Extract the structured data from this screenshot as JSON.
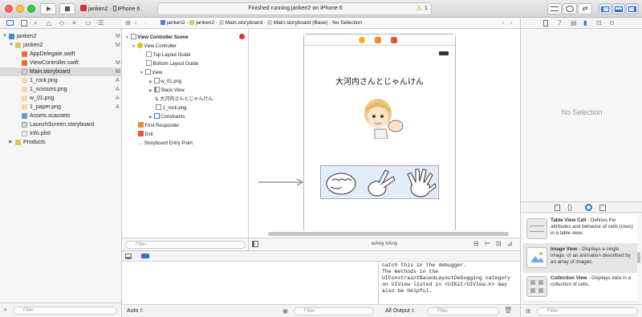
{
  "toolbar": {
    "scheme": "janken2",
    "device": "iPhone 6",
    "status": "Finished running janken2 on iPhone 6",
    "warning_count": "1"
  },
  "navigator": {
    "items": [
      {
        "label": "janken2",
        "badge": "M"
      },
      {
        "label": "janken2",
        "badge": "M"
      },
      {
        "label": "AppDelegate.swift",
        "badge": ""
      },
      {
        "label": "ViewController.swift",
        "badge": "M"
      },
      {
        "label": "Main.storyboard",
        "badge": "M"
      },
      {
        "label": "1_rock.png",
        "badge": "A"
      },
      {
        "label": "1_scissors.png",
        "badge": "A"
      },
      {
        "label": "w_01.png",
        "badge": "A"
      },
      {
        "label": "1_paper.png",
        "badge": "A"
      },
      {
        "label": "Assets.xcassets",
        "badge": ""
      },
      {
        "label": "LaunchScreen.storyboard",
        "badge": ""
      },
      {
        "label": "Info.plist",
        "badge": ""
      },
      {
        "label": "Products",
        "badge": ""
      }
    ],
    "filter_placeholder": "Filter"
  },
  "jumpbar": [
    "janken2",
    "janken2",
    "Main.storyboard",
    "Main.storyboard (Base)",
    "No Selection"
  ],
  "outline": {
    "items": [
      "View Controller Scene",
      "View Controller",
      "Top Layout Guide",
      "Bottom Layout Guide",
      "View",
      "w_01.png",
      "Stack View",
      "大河内さんとじゃんけん",
      "1_rock.png",
      "Constraints",
      "First Responder",
      "Exit",
      "Storyboard Entry Point"
    ],
    "filter_placeholder": "Filter"
  },
  "canvas": {
    "title_label": "大河内さんとじゃんけん",
    "size_class": "wAny hAny"
  },
  "inspector": {
    "empty_text": "No Selection",
    "library": [
      {
        "name": "Table View Cell",
        "desc": " - Defines the attributes and behavior of cells (rows) in a table view."
      },
      {
        "name": "Image View",
        "desc": " - Displays a single image, or an animation described by an array of images."
      },
      {
        "name": "Collection View",
        "desc": " - Displays data in a collection of cells."
      }
    ],
    "filter_placeholder": "Filter"
  },
  "debug": {
    "auto_label": "Auto",
    "output_label": "All Output",
    "filter_placeholder": "Filter",
    "console_lines": [
      "catch this in the debugger.",
      "The methods in the",
      "UIConstraintBasedLayoutDebugging category",
      "on UIView listed in <UIKit/UIView.h> may",
      "also be helpful."
    ]
  }
}
